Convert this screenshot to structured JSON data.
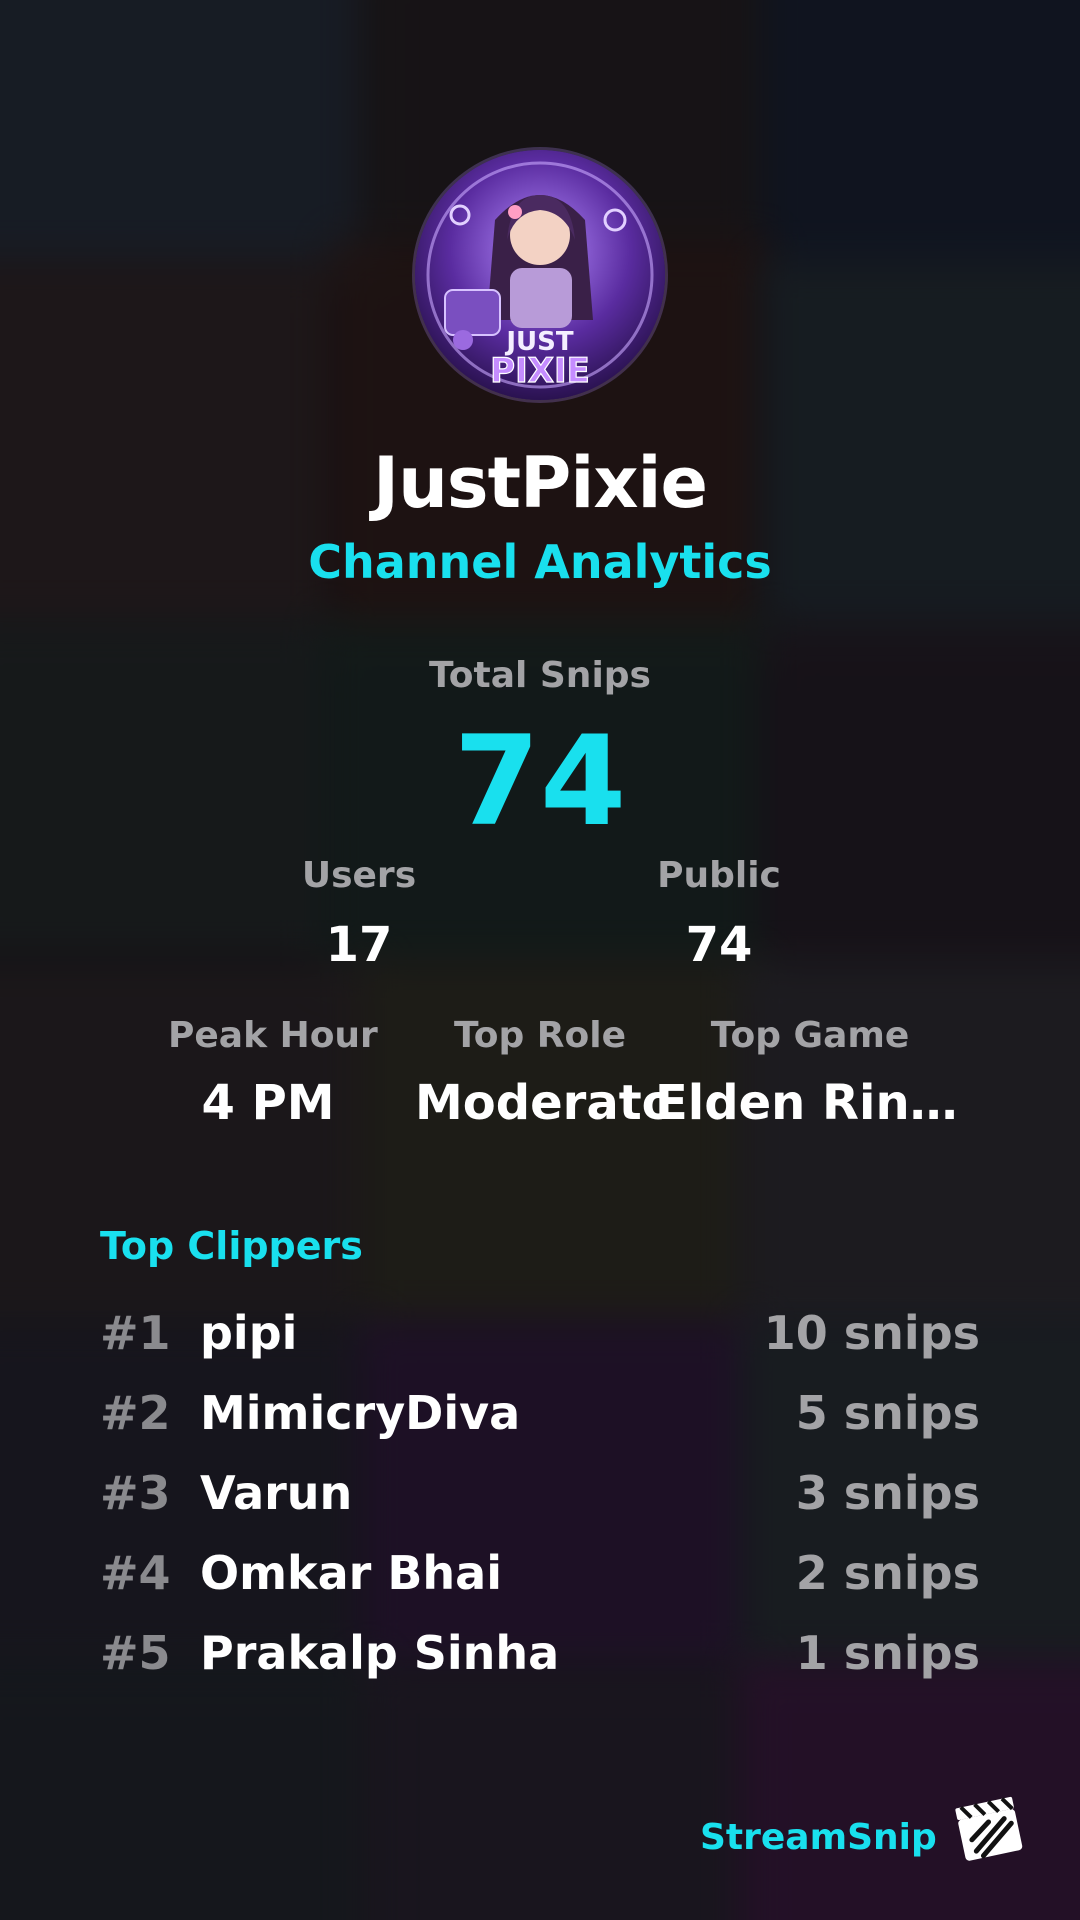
{
  "channel": {
    "name": "JustPixie",
    "subtitle": "Channel Analytics",
    "avatar_icon": "channel-avatar-icon",
    "avatar_text_top": "JUST",
    "avatar_text_bottom": "PIXIE"
  },
  "stats": {
    "total_label": "Total Snips",
    "total_value": "74",
    "users_label": "Users",
    "users_value": "17",
    "public_label": "Public",
    "public_value": "74",
    "peak_label": "Peak Hour",
    "peak_value": "4 PM",
    "role_label": "Top Role",
    "role_value": "Moderator",
    "game_label": "Top Game",
    "game_value": "Elden Ring T.."
  },
  "top_clippers": {
    "title": "Top Clippers",
    "rows": [
      {
        "rank": "#1",
        "name": "pipi",
        "snips": "10 snips"
      },
      {
        "rank": "#2",
        "name": "MimicryDiva",
        "snips": "5 snips"
      },
      {
        "rank": "#3",
        "name": "Varun",
        "snips": "3 snips"
      },
      {
        "rank": "#4",
        "name": "Omkar Bhai",
        "snips": "2 snips"
      },
      {
        "rank": "#5",
        "name": "Prakalp Sinha",
        "snips": "1 snips"
      }
    ]
  },
  "brand": {
    "name": "StreamSnip",
    "logo_icon": "clapperboard-icon"
  },
  "colors": {
    "accent": "#19e0ee",
    "label_gray": "#a3a3a6",
    "rank_gray": "#8a8a8e",
    "text": "#ffffff"
  }
}
